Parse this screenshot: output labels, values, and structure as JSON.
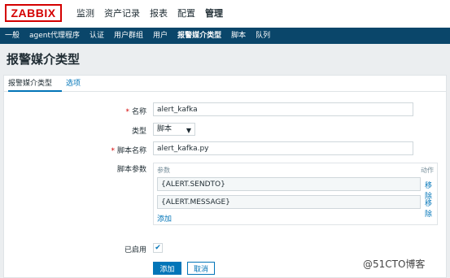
{
  "logo": "ZABBIX",
  "main_nav": [
    {
      "label": "监测",
      "active": false
    },
    {
      "label": "资产记录",
      "active": false
    },
    {
      "label": "报表",
      "active": false
    },
    {
      "label": "配置",
      "active": false
    },
    {
      "label": "管理",
      "active": true
    }
  ],
  "sub_nav": [
    {
      "label": "一般",
      "active": false
    },
    {
      "label": "agent代理程序",
      "active": false
    },
    {
      "label": "认证",
      "active": false
    },
    {
      "label": "用户群组",
      "active": false
    },
    {
      "label": "用户",
      "active": false
    },
    {
      "label": "报警媒介类型",
      "active": true
    },
    {
      "label": "脚本",
      "active": false
    },
    {
      "label": "队列",
      "active": false
    }
  ],
  "page_title": "报警媒介类型",
  "tabs": [
    "报警媒介类型",
    "选项"
  ],
  "form": {
    "name_label": "名称",
    "name_value": "alert_kafka",
    "type_label": "类型",
    "type_value": "脚本",
    "script_name_label": "脚本名称",
    "script_name_value": "alert_kafka.py",
    "script_params_label": "脚本参数",
    "params_header": "参数",
    "action_header": "动作",
    "params": [
      "{ALERT.SENDTO}",
      "{ALERT.MESSAGE}"
    ],
    "remove_label": "移除",
    "add_param_label": "添加",
    "enabled_label": "已启用",
    "required_mark": "*"
  },
  "buttons": {
    "add": "添加",
    "cancel": "取消"
  },
  "watermark": "@51CTO博客",
  "colors": {
    "brand": "#d40000",
    "accent": "#0275b8",
    "subnav": "#0a466a"
  }
}
